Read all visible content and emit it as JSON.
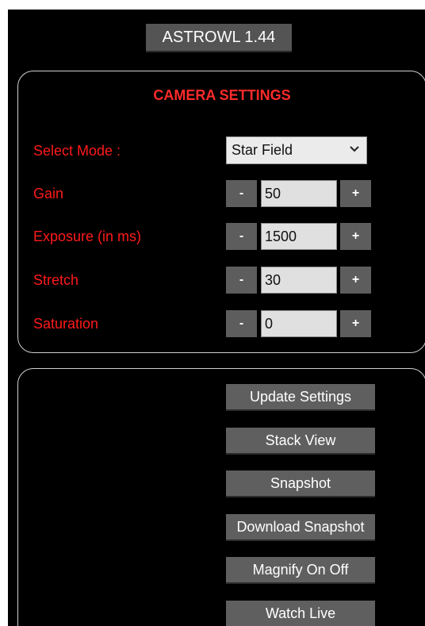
{
  "app": {
    "title": "ASTROWL 1.44"
  },
  "settings": {
    "heading": "CAMERA SETTINGS",
    "mode": {
      "label": "Select Mode :",
      "value": "Star Field"
    },
    "gain": {
      "label": "Gain",
      "value": "50"
    },
    "exposure": {
      "label": "Exposure (in ms)",
      "value": "1500"
    },
    "stretch": {
      "label": "Stretch",
      "value": "30"
    },
    "saturation": {
      "label": "Saturation",
      "value": "0"
    },
    "minus": "-",
    "plus": "+"
  },
  "actions": {
    "update": "Update Settings",
    "stack": "Stack View",
    "snapshot": "Snapshot",
    "download": "Download Snapshot",
    "magnify": "Magnify On Off",
    "watch": "Watch Live"
  },
  "colors": {
    "background": "#000000",
    "label": "#ff1a1a",
    "button": "#5d5d5d"
  }
}
